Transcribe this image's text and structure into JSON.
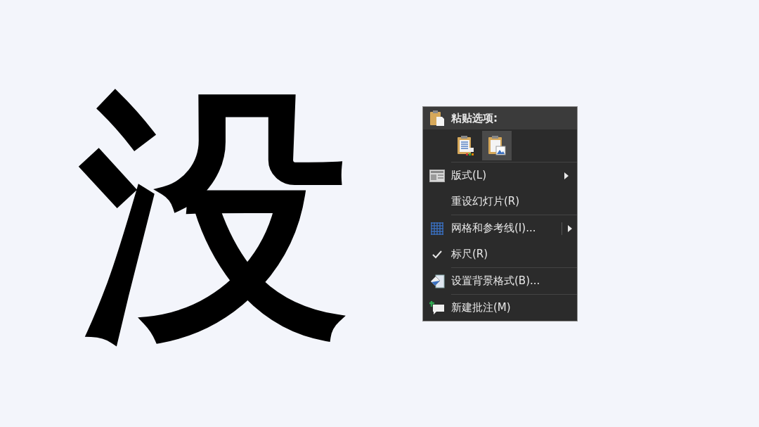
{
  "slide": {
    "character": "没"
  },
  "context_menu": {
    "header": "粘贴选项:",
    "paste_options": [
      {
        "kind": "keep-text",
        "selected": false
      },
      {
        "kind": "picture",
        "selected": true
      }
    ],
    "items": [
      {
        "kind": "layout",
        "label": "版式(L)",
        "submenu": true,
        "checked": false
      },
      {
        "kind": "plain",
        "label": "重设幻灯片(R)",
        "submenu": false,
        "checked": false
      },
      {
        "kind": "grid",
        "label": "网格和参考线(I)...",
        "submenu": true,
        "checked": false
      },
      {
        "kind": "check",
        "label": "标尺(R)",
        "submenu": false,
        "checked": true
      },
      {
        "kind": "background",
        "label": "设置背景格式(B)...",
        "submenu": false,
        "checked": false
      },
      {
        "kind": "comment",
        "label": "新建批注(M)",
        "submenu": false,
        "checked": false
      }
    ]
  }
}
